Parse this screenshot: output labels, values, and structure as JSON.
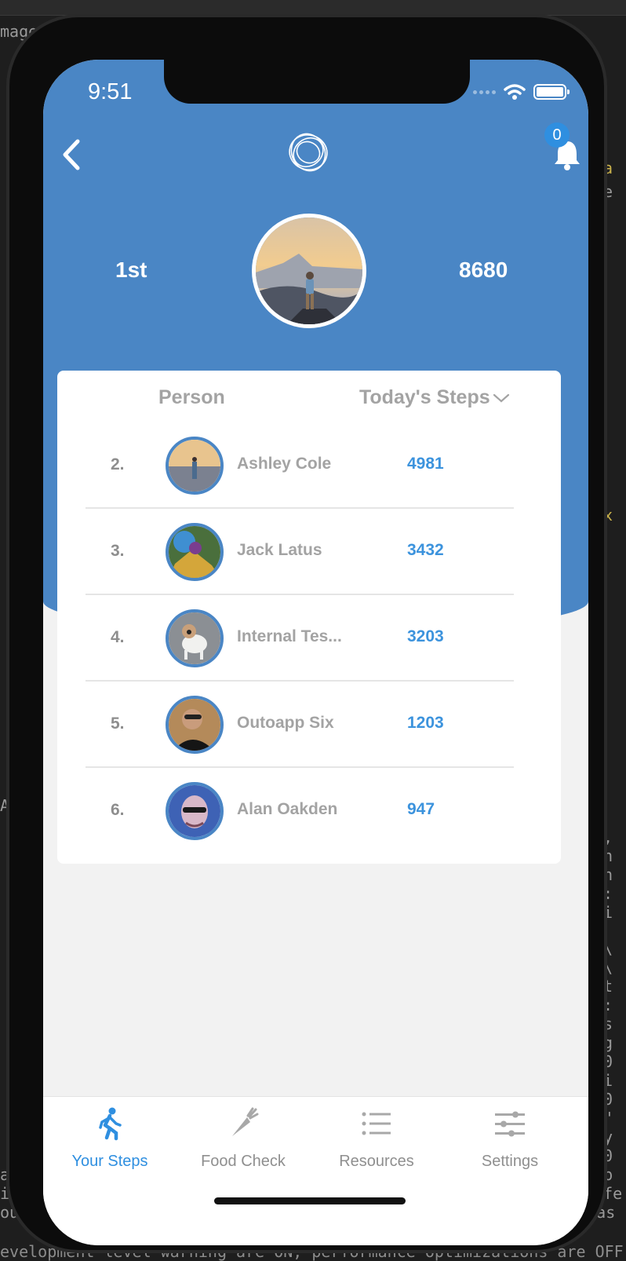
{
  "background": {
    "fragments": [
      "mage",
      "pa",
      "se",
      "ax",
      "},",
      "on",
      "on",
      "\":",
      "_i",
      "e\\",
      " \\",
      "nt",
      "p:",
      "/s",
      "ng",
      ".0",
      "mi",
      ".0",
      ":\"",
      "ny",
      ".0",
      "-ap",
      "Life",
      "s/./as",
      "A",
      "ak",
      "ima",
      "ound"
    ],
    "bottom_line": "evelopment-level warning are ON, performance optimizations are OFF"
  },
  "status_bar": {
    "time": "9:51"
  },
  "header": {
    "rank": "1st",
    "steps": "8680",
    "notification_count": "0"
  },
  "leaderboard": {
    "col_person": "Person",
    "col_steps": "Today's Steps",
    "rows": [
      {
        "rank": "2.",
        "name": "Ashley Cole",
        "steps": "4981"
      },
      {
        "rank": "3.",
        "name": "Jack Latus",
        "steps": "3432"
      },
      {
        "rank": "4.",
        "name": "Internal Tes...",
        "steps": "3203"
      },
      {
        "rank": "5.",
        "name": "Outoapp Six",
        "steps": "1203"
      },
      {
        "rank": "6.",
        "name": "Alan Oakden",
        "steps": "947"
      }
    ]
  },
  "tabs": [
    {
      "label": "Your Steps",
      "icon": "walking-icon",
      "active": true
    },
    {
      "label": "Food Check",
      "icon": "carrot-icon",
      "active": false
    },
    {
      "label": "Resources",
      "icon": "list-icon",
      "active": false
    },
    {
      "label": "Settings",
      "icon": "sliders-icon",
      "active": false
    }
  ],
  "colors": {
    "header_blue": "#4a86c5",
    "accent_blue": "#2f8fe0",
    "steps_blue": "#3c93dd",
    "muted_text": "#a3a3a3"
  }
}
